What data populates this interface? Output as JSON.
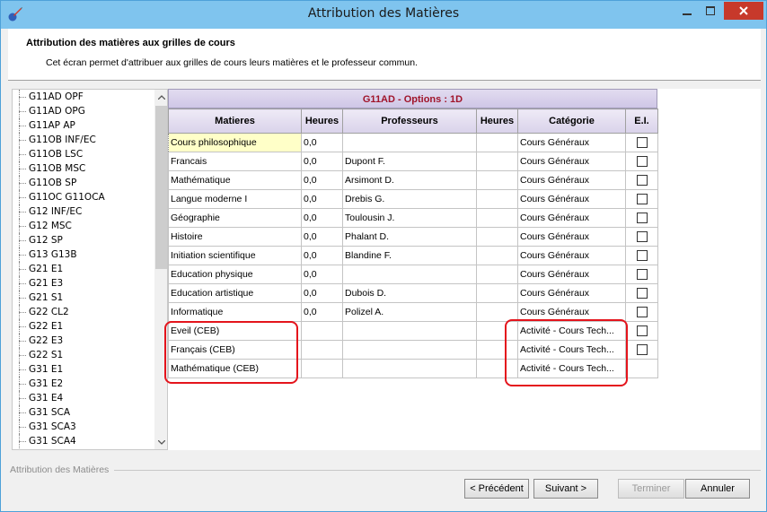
{
  "window": {
    "title": "Attribution des Matières"
  },
  "header": {
    "title": "Attribution des matières aux grilles de cours",
    "description": "Cet écran permet d'attribuer aux grilles de cours leurs matières et le professeur commun."
  },
  "tree": {
    "items": [
      "G11AD OPF",
      "G11AD OPG",
      "G11AP AP",
      "G11OB INF/EC",
      "G11OB LSC",
      "G11OB MSC",
      "G11OB SP",
      "G11OC G11OCA",
      "G12 INF/EC",
      "G12 MSC",
      "G12 SP",
      "G13 G13B",
      "G21 E1",
      "G21 E3",
      "G21 S1",
      "G22 CL2",
      "G22 E1",
      "G22 E3",
      "G22 S1",
      "G31 E1",
      "G31 E2",
      "G31 E4",
      "G31 SCA",
      "G31 SCA3",
      "G31 SCA4"
    ]
  },
  "grid": {
    "title": "G11AD  -  Options : 1D",
    "columns": [
      "Matieres",
      "Heures",
      "Professeurs",
      "Heures",
      "Catégorie",
      "E.I."
    ],
    "rows": [
      {
        "matiere": "Cours philosophique",
        "heures": "0,0",
        "professeur": "",
        "heures2": "",
        "categorie": "Cours Généraux",
        "ei": "checkbox"
      },
      {
        "matiere": "Francais",
        "heures": "0,0",
        "professeur": "Dupont F.",
        "heures2": "",
        "categorie": "Cours Généraux",
        "ei": "checkbox"
      },
      {
        "matiere": "Mathématique",
        "heures": "0,0",
        "professeur": "Arsimont D.",
        "heures2": "",
        "categorie": "Cours Généraux",
        "ei": "checkbox"
      },
      {
        "matiere": "Langue moderne I",
        "heures": "0,0",
        "professeur": "Drebis G.",
        "heures2": "",
        "categorie": "Cours Généraux",
        "ei": "checkbox"
      },
      {
        "matiere": "Géographie",
        "heures": "0,0",
        "professeur": "Toulousin J.",
        "heures2": "",
        "categorie": "Cours Généraux",
        "ei": "checkbox"
      },
      {
        "matiere": "Histoire",
        "heures": "0,0",
        "professeur": "Phalant D.",
        "heures2": "",
        "categorie": "Cours Généraux",
        "ei": "checkbox"
      },
      {
        "matiere": "Initiation scientifique",
        "heures": "0,0",
        "professeur": "Blandine F.",
        "heures2": "",
        "categorie": "Cours Généraux",
        "ei": "checkbox"
      },
      {
        "matiere": "Education physique",
        "heures": "0,0",
        "professeur": "",
        "heures2": "",
        "categorie": "Cours Généraux",
        "ei": "checkbox"
      },
      {
        "matiere": "Education artistique",
        "heures": "0,0",
        "professeur": "Dubois D.",
        "heures2": "",
        "categorie": "Cours Généraux",
        "ei": "checkbox"
      },
      {
        "matiere": "Informatique",
        "heures": "0,0",
        "professeur": "Polizel A.",
        "heures2": "",
        "categorie": "Cours Généraux",
        "ei": "checkbox"
      },
      {
        "matiere": "Eveil (CEB)",
        "heures": "",
        "professeur": "",
        "heures2": "",
        "categorie": "Activité - Cours Tech...",
        "ei": "checkbox"
      },
      {
        "matiere": "Français (CEB)",
        "heures": "",
        "professeur": "",
        "heures2": "",
        "categorie": "Activité - Cours Tech...",
        "ei": "checkbox"
      },
      {
        "matiere": "Mathématique (CEB)",
        "heures": "",
        "professeur": "",
        "heures2": "",
        "categorie": "Activité - Cours Tech...",
        "ei": ""
      }
    ]
  },
  "footer": {
    "group_label": "Attribution des Matières",
    "buttons": {
      "previous": "< Précédent",
      "next": "Suivant >",
      "finish": "Terminer",
      "cancel": "Annuler"
    }
  },
  "colors": {
    "titlebar": "#7fc4ee",
    "close_button": "#c7392b",
    "grid_title_text": "#a0142a",
    "highlight": "#e4141c",
    "selected_cell": "#ffffc8"
  },
  "icons": {
    "app": "pen-ball-icon",
    "minimize": "minimize-icon",
    "maximize": "maximize-icon",
    "close": "close-icon"
  }
}
